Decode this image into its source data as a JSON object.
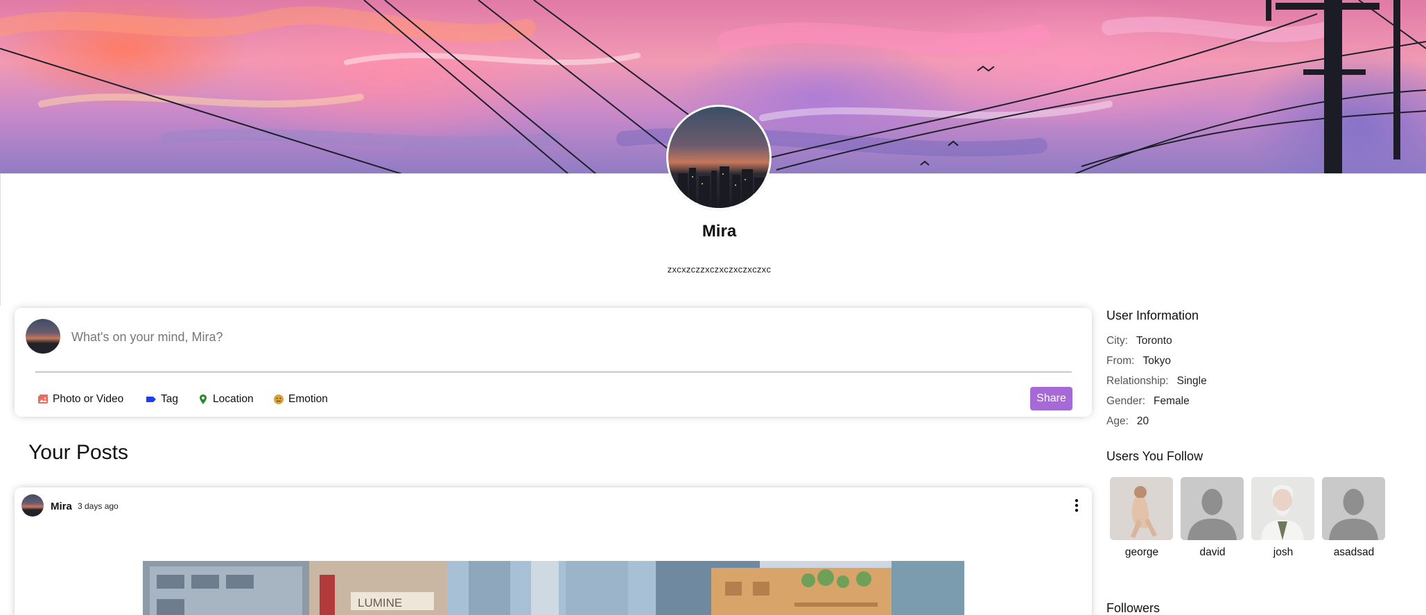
{
  "profile": {
    "name": "Mira",
    "description": "zxcxzczzxczxczxczxczxc"
  },
  "share": {
    "placeholder": "What's on your mind, Mira?",
    "options": [
      {
        "label": "Photo or Video",
        "icon": "photo-icon",
        "color": "#e86b5e"
      },
      {
        "label": "Tag",
        "icon": "tag-icon",
        "color": "#1e3cf0"
      },
      {
        "label": "Location",
        "icon": "location-icon",
        "color": "#2a8a2a"
      },
      {
        "label": "Emotion",
        "icon": "emotion-icon",
        "color": "#d6a53a"
      }
    ],
    "button_label": "Share",
    "button_color": "#a66ad6"
  },
  "posts_section": {
    "title": "Your Posts"
  },
  "post": {
    "username": "Mira",
    "date": "3 days ago",
    "image_text": "LUMINE"
  },
  "user_info": {
    "title": "User Information",
    "rows": [
      {
        "key": "City:",
        "value": "Toronto"
      },
      {
        "key": "From:",
        "value": "Tokyo"
      },
      {
        "key": "Relationship:",
        "value": "Single"
      },
      {
        "key": "Gender:",
        "value": "Female"
      },
      {
        "key": "Age:",
        "value": "20"
      }
    ]
  },
  "following": {
    "title": "Users You Follow",
    "users": [
      {
        "name": "george"
      },
      {
        "name": "david"
      },
      {
        "name": "josh"
      },
      {
        "name": "asadsad"
      }
    ]
  },
  "followers": {
    "title": "Followers"
  }
}
